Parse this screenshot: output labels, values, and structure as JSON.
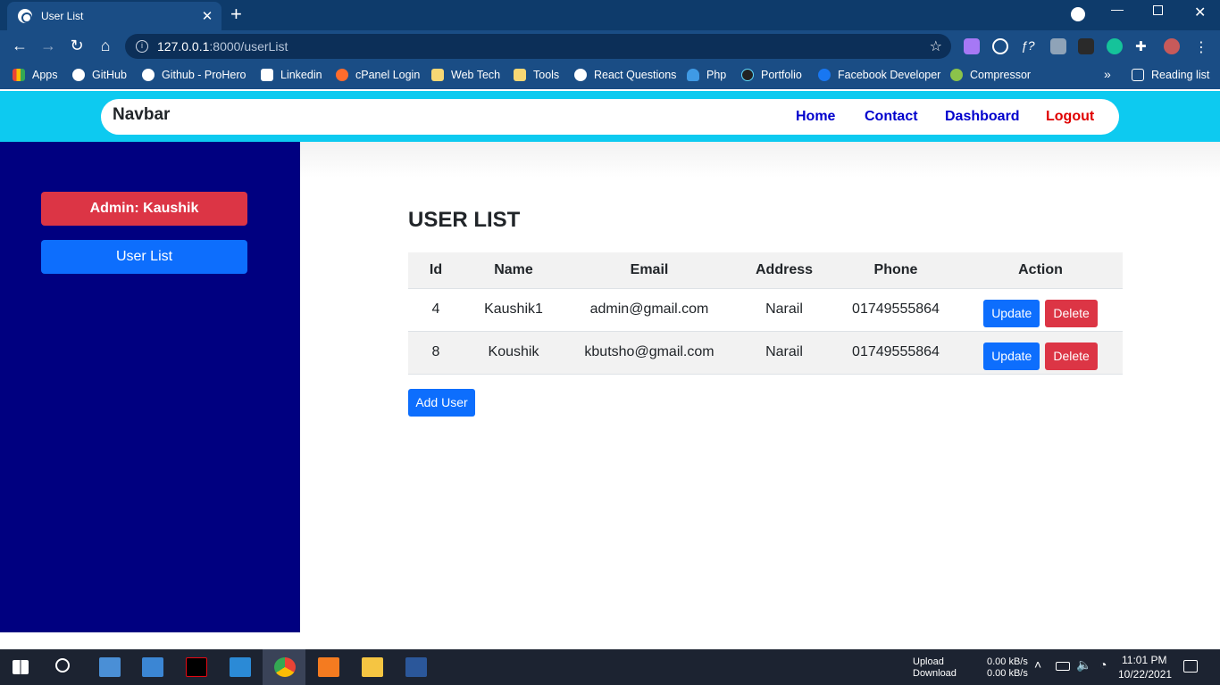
{
  "browser": {
    "tab_title": "User List",
    "tab_close": "✕",
    "new_tab": "+",
    "url_host": "127.0.0.1",
    "url_path": ":8000/userList",
    "bookmarks": [
      "Apps",
      "GitHub",
      "Github - ProHero",
      "Linkedin",
      "cPanel Login",
      "Web Tech",
      "Tools",
      "React Questions",
      "Php",
      "Portfolio",
      "Facebook Developer",
      "Compressor"
    ],
    "more_bookmarks": "»",
    "reading_list": "Reading list"
  },
  "navbar": {
    "brand": "Navbar",
    "links": [
      "Home",
      "Contact",
      "Dashboard",
      "Logout"
    ]
  },
  "sidebar": {
    "admin_label": "Admin: Kaushik",
    "user_list_button": "User List"
  },
  "main": {
    "title": "USER LIST",
    "columns": [
      "Id",
      "Name",
      "Email",
      "Address",
      "Phone",
      "Action"
    ],
    "rows": [
      {
        "id": "4",
        "name": "Kaushik1",
        "email": "admin@gmail.com",
        "address": "Narail",
        "phone": "01749555864"
      },
      {
        "id": "8",
        "name": "Koushik",
        "email": "kbutsho@gmail.com",
        "address": "Narail",
        "phone": "01749555864"
      }
    ],
    "update_label": "Update",
    "delete_label": "Delete",
    "add_user_label": "Add User"
  },
  "taskbar": {
    "upload_label": "Upload",
    "download_label": "Download",
    "upload_rate": "0.00 kB/s",
    "download_rate": "0.00 kB/s",
    "time": "11:01 PM",
    "date": "10/22/2021"
  },
  "colors": {
    "navbar_bg": "#0dcaf0",
    "sidebar_bg": "#000080",
    "primary": "#0d6efd",
    "danger": "#dc3545"
  }
}
